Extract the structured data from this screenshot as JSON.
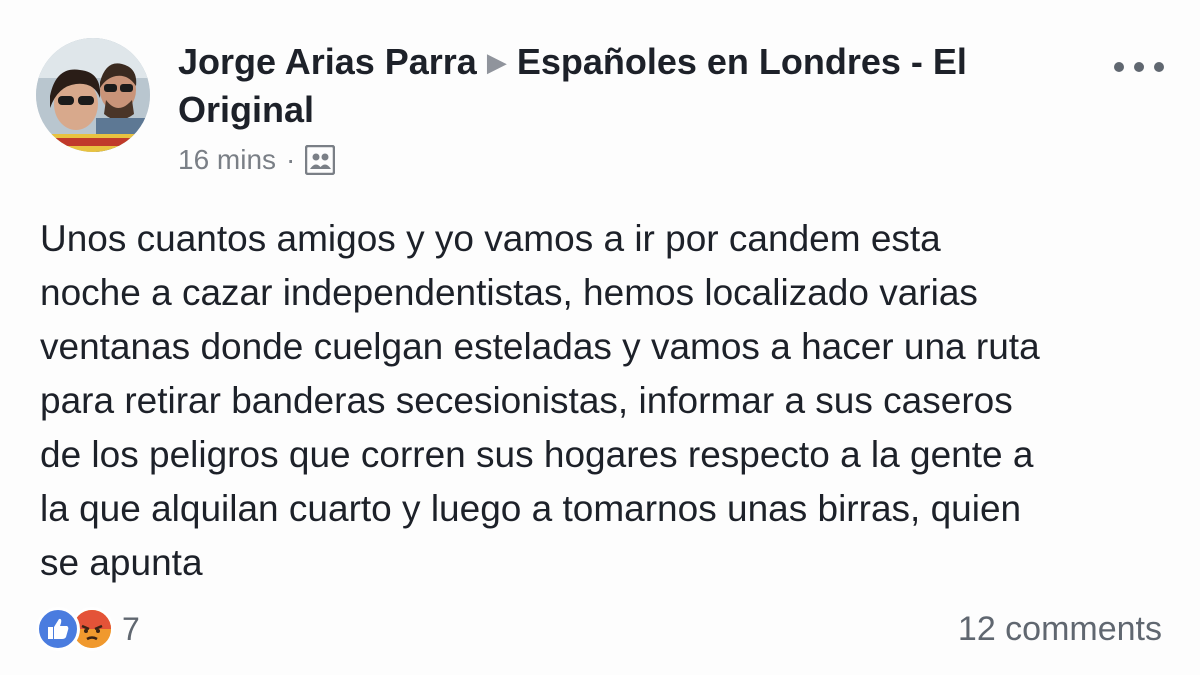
{
  "post": {
    "author": "Jorge Arias Parra",
    "group": "Españoles en Londres - El Original",
    "timestamp": "16 mins",
    "separator": "·",
    "audience_icon": "group-icon",
    "text": "Unos cuantos amigos y yo vamos a ir por candem esta\nnoche a cazar independentistas, hemos localizado varias\nventanas donde cuelgan esteladas y vamos a hacer una ruta\npara retirar banderas secesionistas, informar a sus caseros\nde los peligros que corren sus hogares respecto a la gente a\nla que alquilan cuarto  y luego a tomarnos unas birras, quien\nse apunta",
    "reactions": {
      "types": [
        "like-icon",
        "angry-icon"
      ],
      "count": "7"
    },
    "comments_label": "12 comments",
    "more_icon": "more-options-icon"
  },
  "colors": {
    "like": "#4a7cdf",
    "angry": "#f0992e",
    "text": "#1d2129",
    "meta": "#7a7f86"
  }
}
